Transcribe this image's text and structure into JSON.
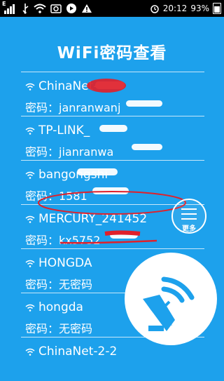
{
  "status_bar": {
    "network_badge": "E",
    "time": "20:12",
    "battery": "93%"
  },
  "header": {
    "title": "WiFi密码查看"
  },
  "networks": [
    {
      "ssid": "ChinaNet-",
      "password": "密码：janranwanj"
    },
    {
      "ssid": "TP-LINK_",
      "password": "密码：jianranwa"
    },
    {
      "ssid": "bangongshi",
      "password": "密码：1581"
    },
    {
      "ssid": "MERCURY_241452",
      "password": "密码：kx5752"
    },
    {
      "ssid": "HONGDA",
      "password": "密码：无密码"
    },
    {
      "ssid": "hongda",
      "password": "密码：无密码"
    },
    {
      "ssid": "ChinaNet-2-2",
      "password": ""
    }
  ],
  "fab": {
    "more_label": "更多"
  },
  "colors": {
    "background": "#1da1ec",
    "annotation": "#e0202a",
    "text": "#ffffff"
  }
}
